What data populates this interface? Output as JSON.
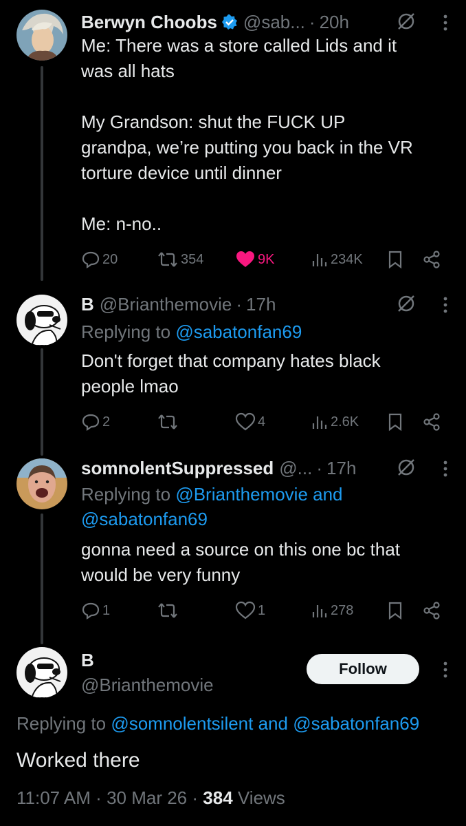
{
  "colors": {
    "accent": "#1d9bf0",
    "like": "#f91880",
    "muted": "#71767b",
    "text": "#e7e9ea",
    "background": "#000000"
  },
  "tweets": [
    {
      "name": "Berwyn Choobs",
      "handle": "@sab...",
      "dot": "·",
      "time": "20h",
      "verified": true,
      "text": "Me: There was a store called Lids and it\nwas all hats\n\nMy Grandson: shut the FUCK UP\ngrandpa, we’re putting you back in the VR\ntorture device until dinner\n\nMe: n-no..",
      "replies": "20",
      "reposts": "354",
      "likes": "9K",
      "views": "234K"
    },
    {
      "name": "B",
      "handle": "@Brianthemovie",
      "dot": "·",
      "time": "17h",
      "reply_prefix": "Replying to ",
      "reply_to": "@sabatonfan69",
      "text": "Don't forget that company hates black\npeople lmao",
      "replies": "2",
      "reposts": "",
      "likes": "4",
      "views": "2.6K"
    },
    {
      "name": "somnolentSuppressed",
      "handle": "@...",
      "dot": "·",
      "time": "17h",
      "reply_prefix": "Replying to ",
      "reply_to_1": "@Brianthemovie and",
      "reply_to_2": "@sabatonfan69",
      "text": "gonna need a source on this one bc that\nwould be very funny",
      "replies": "1",
      "reposts": "",
      "likes": "1",
      "views": "278"
    }
  ],
  "focus": {
    "name": "B",
    "handle": "@Brianthemovie",
    "follow_label": "Follow",
    "reply_prefix": "Replying to ",
    "reply_to": "@somnolentsilent and @sabatonfan69",
    "text": "Worked there",
    "time": "11:07 AM",
    "date": "30 Mar 26",
    "sep": "·",
    "views_count": "384",
    "views_label": "Views"
  }
}
